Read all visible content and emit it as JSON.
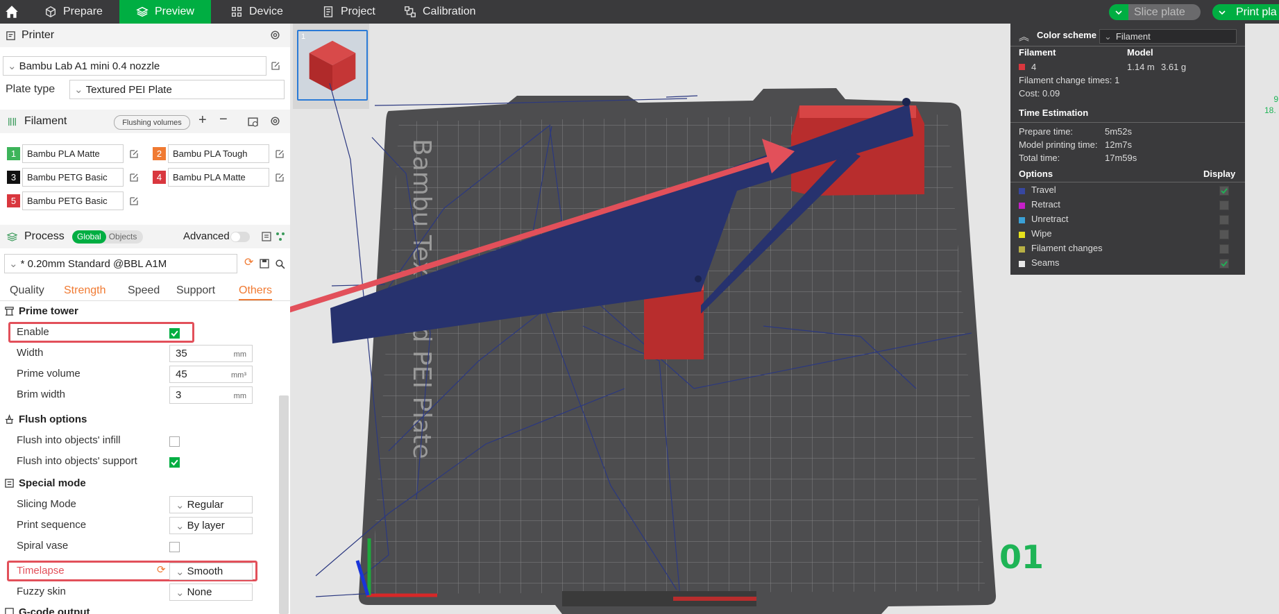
{
  "topbar": {
    "tabs": [
      "Prepare",
      "Preview",
      "Device",
      "Project",
      "Calibration"
    ],
    "slice_label": "Slice plate",
    "print_label": "Print pla"
  },
  "printer": {
    "section_label": "Printer",
    "printer_name": "Bambu Lab A1 mini 0.4 nozzle",
    "plate_type_label": "Plate type",
    "plate_type_value": "Textured PEI Plate"
  },
  "filament": {
    "section_label": "Filament",
    "flushing_label": "Flushing volumes",
    "items": [
      {
        "num": "1",
        "name": "Bambu PLA Matte",
        "color": "#3db45a"
      },
      {
        "num": "2",
        "name": "Bambu PLA Tough",
        "color": "#f07a32"
      },
      {
        "num": "3",
        "name": "Bambu PETG Basic",
        "color": "#111111"
      },
      {
        "num": "4",
        "name": "Bambu PLA Matte",
        "color": "#d9373e"
      },
      {
        "num": "5",
        "name": "Bambu PETG Basic",
        "color": "#d9373e"
      }
    ]
  },
  "process": {
    "section_label": "Process",
    "global_label": "Global",
    "objects_label": "Objects",
    "advanced_label": "Advanced",
    "preset": "* 0.20mm Standard @BBL A1M",
    "tabs": [
      "Quality",
      "Strength",
      "Speed",
      "Support",
      "Others"
    ]
  },
  "prime_tower": {
    "title": "Prime tower",
    "enable_label": "Enable",
    "width_label": "Width",
    "width_value": "35",
    "width_unit": "mm",
    "prime_volume_label": "Prime volume",
    "prime_volume_value": "45",
    "prime_volume_unit": "mm³",
    "brim_label": "Brim width",
    "brim_value": "3",
    "brim_unit": "mm"
  },
  "flush": {
    "title": "Flush options",
    "infill_label": "Flush into objects' infill",
    "support_label": "Flush into objects' support"
  },
  "special": {
    "title": "Special mode",
    "slicing_label": "Slicing Mode",
    "slicing_value": "Regular",
    "sequence_label": "Print sequence",
    "sequence_value": "By layer",
    "spiral_label": "Spiral vase",
    "timelapse_label": "Timelapse",
    "timelapse_value": "Smooth",
    "fuzzy_label": "Fuzzy skin",
    "fuzzy_value": "None",
    "gcode_label": "G-code output"
  },
  "viewport": {
    "plate_num": "01",
    "thumb_num": "1",
    "plate_text": "Bambu Textured PEI Plate",
    "stat1": "9",
    "stat2": "18."
  },
  "legend": {
    "color_scheme_label": "Color scheme",
    "color_scheme_value": "Filament",
    "col_filament": "Filament",
    "col_model": "Model",
    "fil_num": "4",
    "fil_len": "1.14 m",
    "fil_weight": "3.61 g",
    "change_times": "Filament change times:  1",
    "cost": "Cost:  0.09",
    "time_title": "Time Estimation",
    "prepare_label": "Prepare time:",
    "prepare_value": "5m52s",
    "model_label": "Model printing time:",
    "model_value": "12m7s",
    "total_label": "Total time:",
    "total_value": "17m59s",
    "options_title": "Options",
    "display_title": "Display",
    "options": [
      {
        "label": "Travel",
        "color": "#3747a0",
        "checked": true
      },
      {
        "label": "Retract",
        "color": "#c61fc9",
        "checked": false
      },
      {
        "label": "Unretract",
        "color": "#3aa0d6",
        "checked": false
      },
      {
        "label": "Wipe",
        "color": "#e6e11c",
        "checked": false
      },
      {
        "label": "Filament changes",
        "color": "#b8b045",
        "checked": false
      },
      {
        "label": "Seams",
        "color": "#e8e8e8",
        "checked": true
      }
    ]
  }
}
